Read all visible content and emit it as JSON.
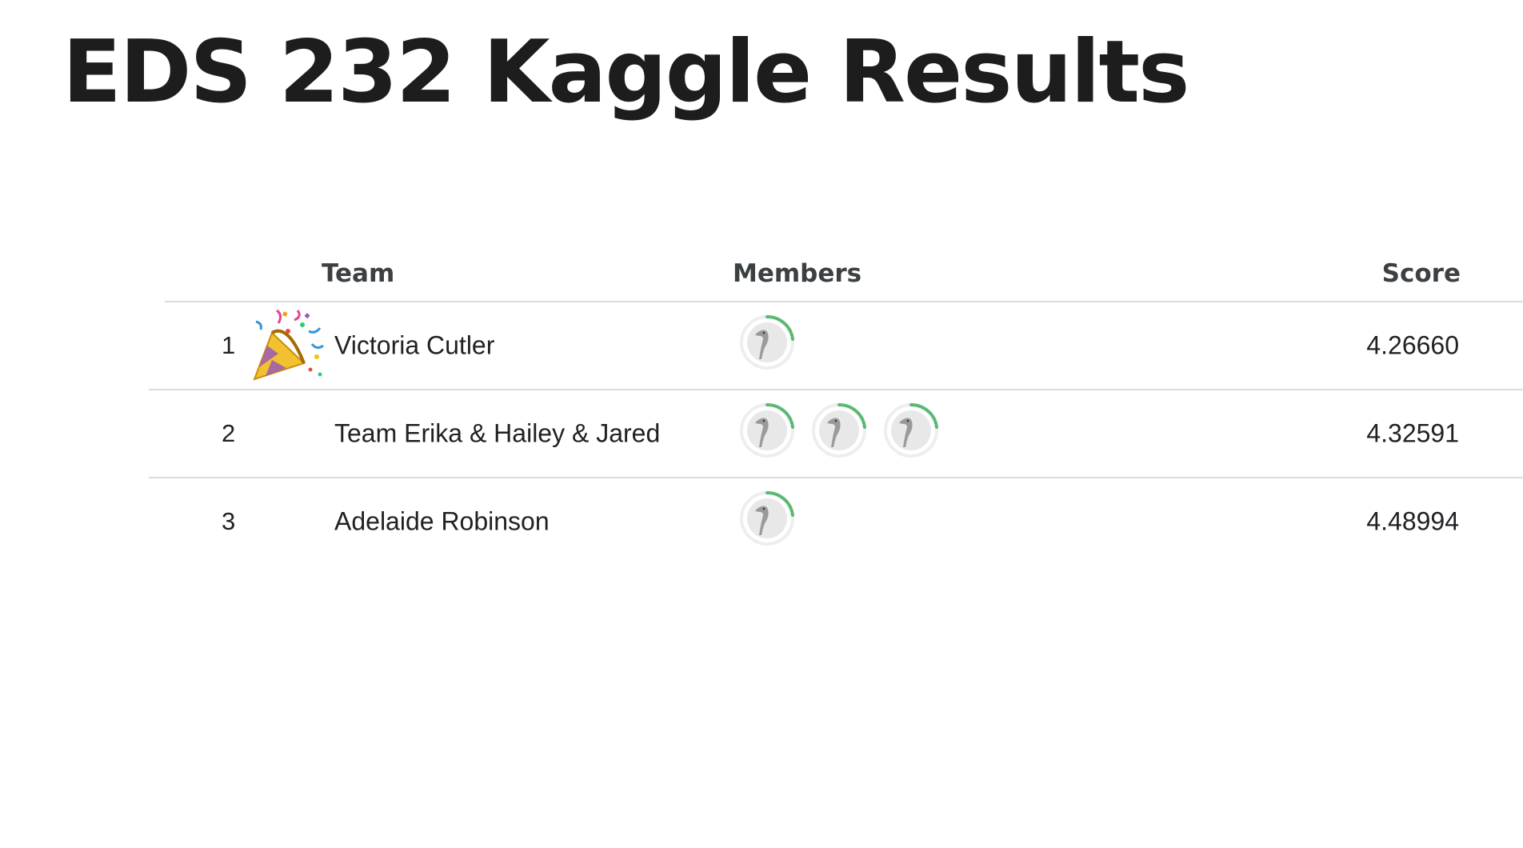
{
  "title": "EDS 232 Kaggle Results",
  "leaderboard": {
    "headers": {
      "team": "Team",
      "members": "Members",
      "score": "Score"
    },
    "rows": [
      {
        "rank": "1",
        "team": "Victoria Cutler",
        "members": 1,
        "score": "4.26660",
        "badge": "party-popper-icon"
      },
      {
        "rank": "2",
        "team": "Team Erika & Hailey & Jared",
        "members": 3,
        "score": "4.32591"
      },
      {
        "rank": "3",
        "team": "Adelaide Robinson",
        "members": 1,
        "score": "4.48994"
      }
    ],
    "avatar_icon": "goose-avatar-icon",
    "avatar_ring_color": "#5bb974",
    "divider_color": "#dadce0"
  }
}
